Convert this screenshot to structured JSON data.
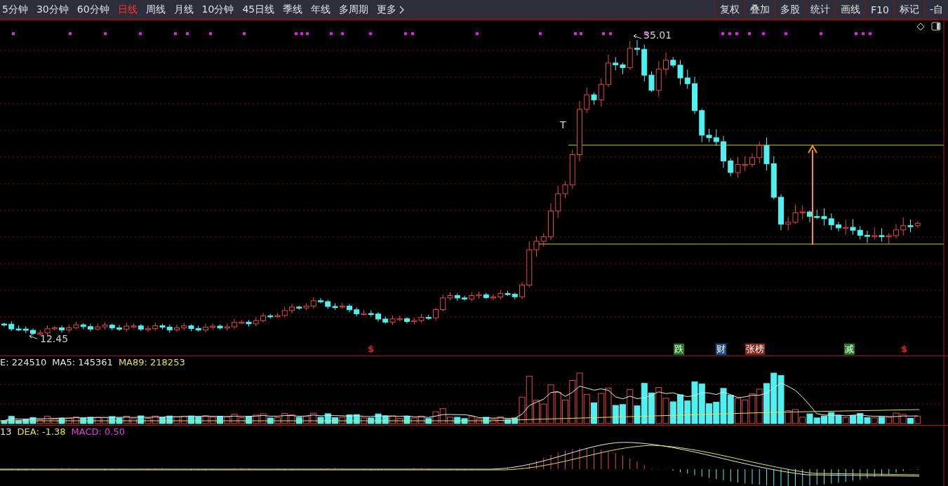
{
  "toolbar": {
    "periods": [
      {
        "label": "5分钟",
        "selected": false
      },
      {
        "label": "30分钟",
        "selected": false
      },
      {
        "label": "60分钟",
        "selected": false
      },
      {
        "label": "日线",
        "selected": true
      },
      {
        "label": "周线",
        "selected": false
      },
      {
        "label": "月线",
        "selected": false
      },
      {
        "label": "10分钟",
        "selected": false
      },
      {
        "label": "45日线",
        "selected": false
      },
      {
        "label": "季线",
        "selected": false
      },
      {
        "label": "年线",
        "selected": false
      },
      {
        "label": "多周期",
        "selected": false
      },
      {
        "label": "更多",
        "selected": false
      }
    ],
    "tools": [
      "复权",
      "叠加",
      "多股",
      "统计",
      "画线",
      "F10",
      "标记",
      "-自"
    ]
  },
  "price_chart": {
    "high_label": "35.01",
    "low_label": "12.45",
    "marker": "T",
    "events": [
      {
        "label": "$",
        "color": "#e02020"
      },
      {
        "label": "跌",
        "color": "#1e7a1e"
      },
      {
        "label": "财",
        "color": "#1f4f8a"
      },
      {
        "label": "张榜",
        "color": "#8a2a1a"
      },
      {
        "label": "减",
        "color": "#1e7a1e"
      },
      {
        "label": "$",
        "color": "#e02020"
      }
    ]
  },
  "volume_panel": {
    "legend": [
      {
        "text": "E: 224510",
        "color": "#e6e6e6"
      },
      {
        "text": "MA5: 145361",
        "color": "#e6e6e6"
      },
      {
        "text": "MA89: 218253",
        "color": "#e8e050"
      }
    ]
  },
  "macd_panel": {
    "legend": [
      {
        "text": "13",
        "color": "#e6e6e6"
      },
      {
        "text": "DEA: -1.38",
        "color": "#e8e050"
      },
      {
        "text": "MACD: 0.50",
        "color": "#e040e0"
      }
    ]
  }
}
